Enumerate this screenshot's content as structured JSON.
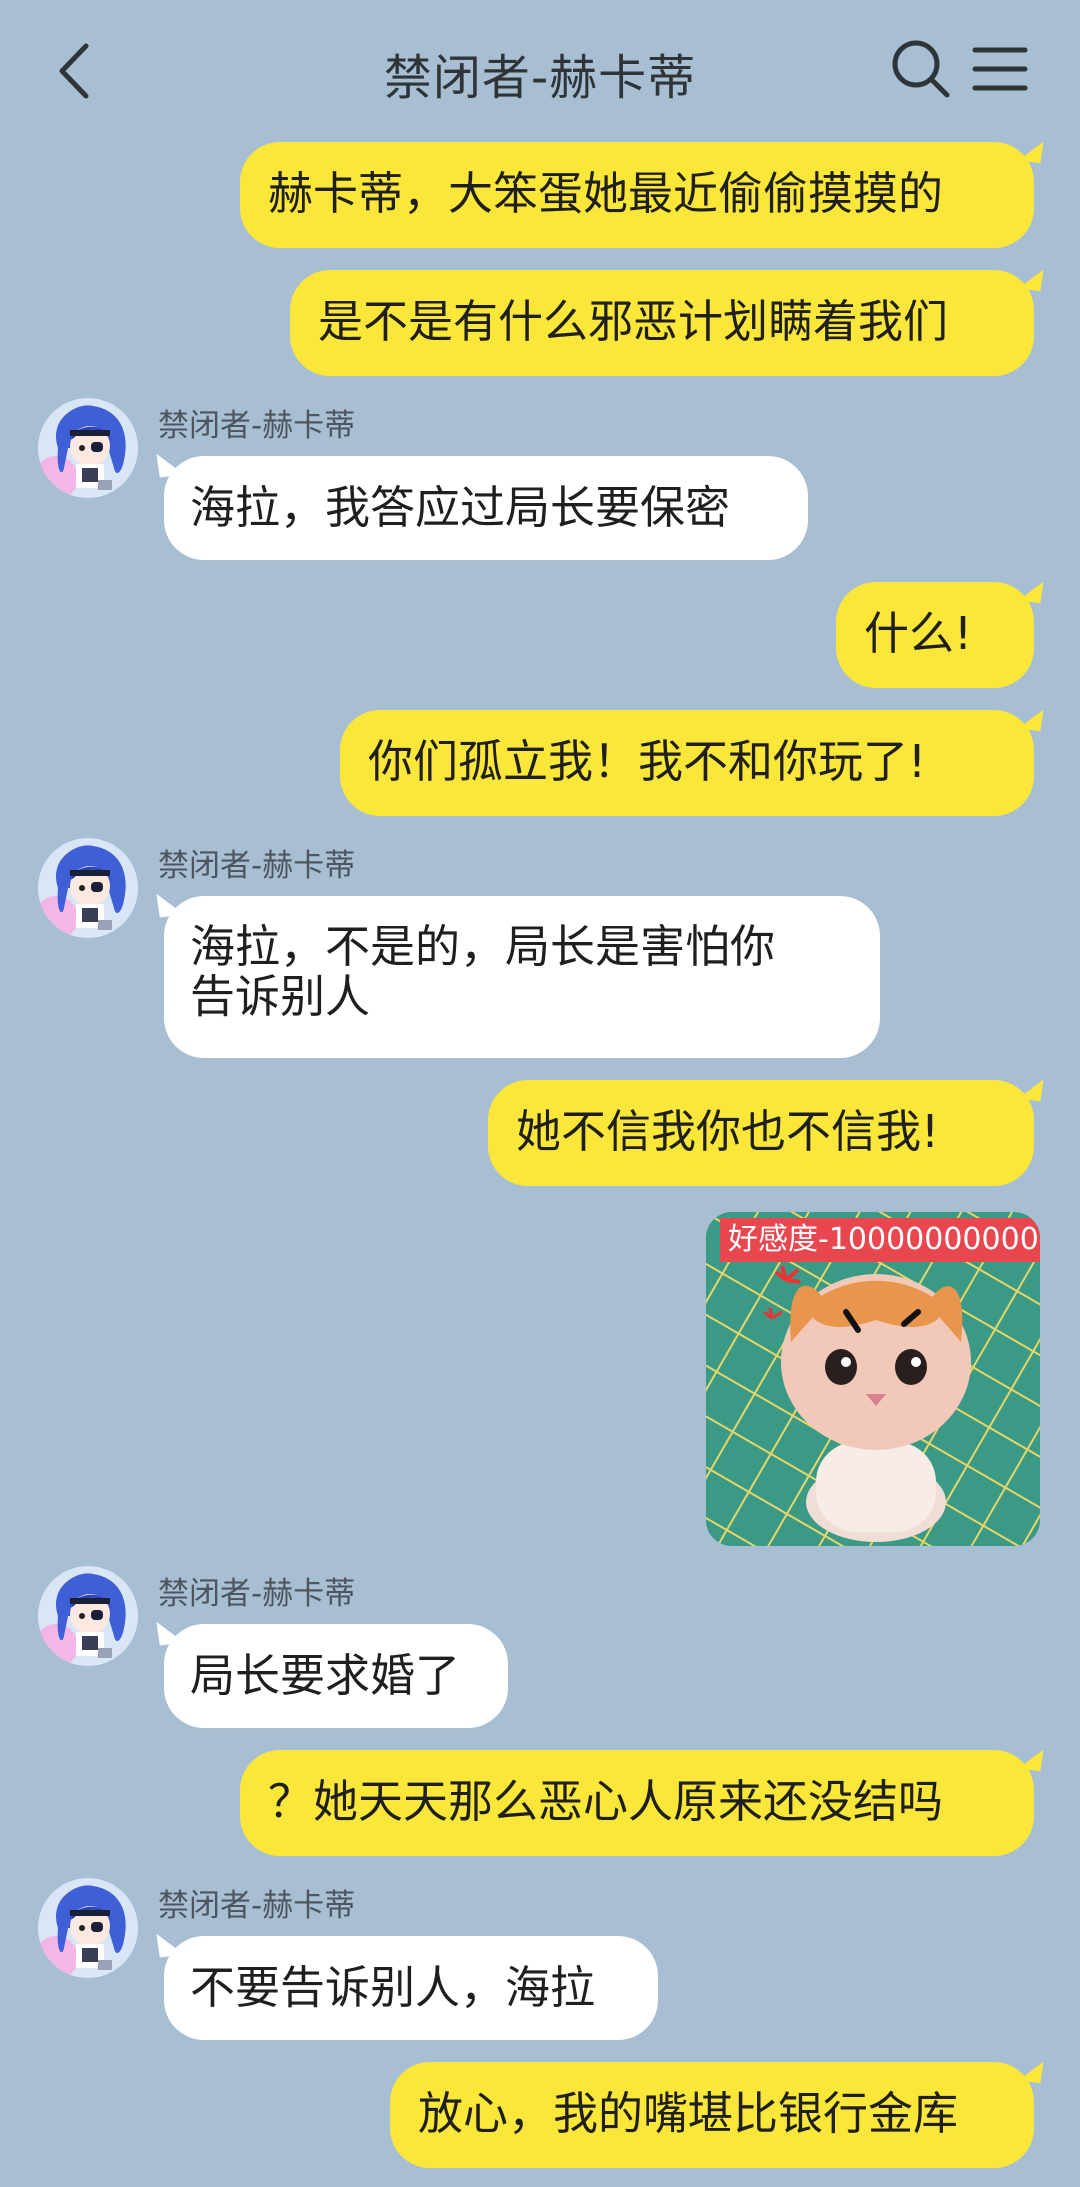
{
  "header": {
    "title": "禁闭者-赫卡蒂"
  },
  "contact": {
    "name": "禁闭者-赫卡蒂"
  },
  "messages": [
    {
      "side": "out",
      "text": "赫卡蒂，大笨蛋她最近偷偷摸摸的"
    },
    {
      "side": "out",
      "text": "是不是有什么邪恶计划瞒着我们"
    },
    {
      "side": "in",
      "sender": "禁闭者-赫卡蒂",
      "text": "海拉，我答应过局长要保密"
    },
    {
      "side": "out",
      "text": "什么!"
    },
    {
      "side": "out",
      "text": "你们孤立我！我不和你玩了!"
    },
    {
      "side": "in",
      "sender": "禁闭者-赫卡蒂",
      "text": "海拉，不是的，局长是害怕你",
      "text2": "告诉别人"
    },
    {
      "side": "out",
      "text": "她不信我你也不信我!"
    },
    {
      "side": "out",
      "type": "sticker",
      "label": "好感度-10000000000"
    },
    {
      "side": "in",
      "sender": "禁闭者-赫卡蒂",
      "text": "局长要求婚了"
    },
    {
      "side": "out",
      "text": "？她天天那么恶心人原来还没结吗"
    },
    {
      "side": "in",
      "sender": "禁闭者-赫卡蒂",
      "text": "不要告诉别人，海拉"
    },
    {
      "side": "out",
      "text": "放心，我的嘴堪比银行金库"
    }
  ],
  "icons": {
    "back": "chevron-left-icon",
    "search": "search-icon",
    "menu": "menu-icon"
  },
  "colors": {
    "background": "#a8bfd3",
    "outgoing_bubble": "#fbe73a",
    "incoming_bubble": "#ffffff",
    "sticker_label": "#e8474f"
  }
}
